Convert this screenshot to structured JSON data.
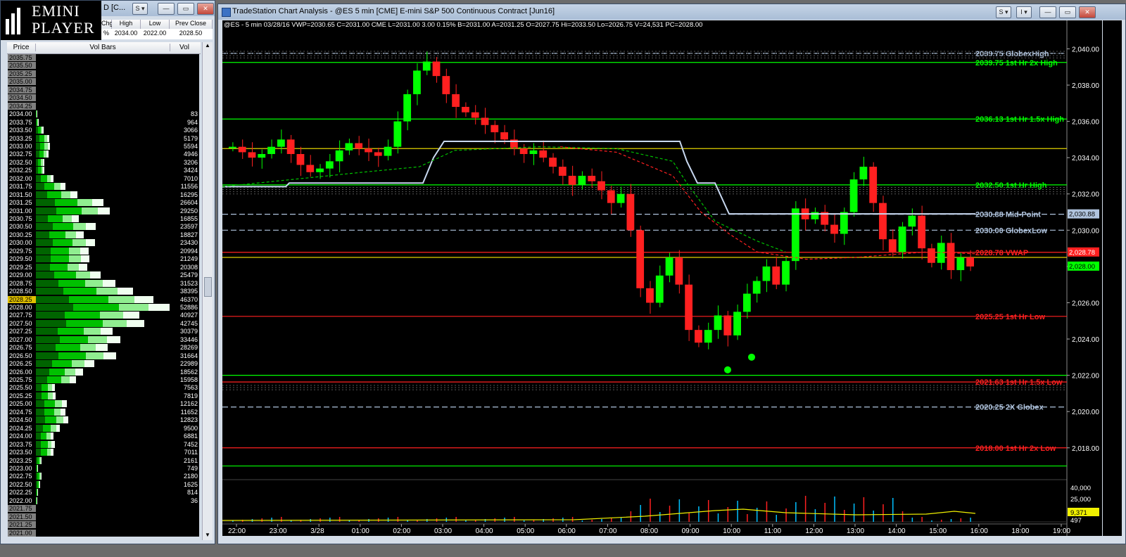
{
  "logo": {
    "line1": "EMINI",
    "line2": "PLAYER"
  },
  "dom_window": {
    "title": "D [C...",
    "header": {
      "col_chg": "Chg",
      "col_high": "High",
      "col_low": "Low",
      "col_prev": "Prev Close"
    },
    "values": {
      "pct": "%",
      "high": "2034.00",
      "low": "2022.00",
      "prev_close": "2028.50"
    },
    "columns": {
      "price": "Price",
      "bars": "Vol Bars",
      "vol": "Vol"
    },
    "current_price": "2028.25",
    "rows": [
      {
        "p": "2035.75",
        "v": ""
      },
      {
        "p": "2035.50",
        "v": ""
      },
      {
        "p": "2035.25",
        "v": ""
      },
      {
        "p": "2035.00",
        "v": ""
      },
      {
        "p": "2034.75",
        "v": ""
      },
      {
        "p": "2034.50",
        "v": ""
      },
      {
        "p": "2034.25",
        "v": ""
      },
      {
        "p": "2034.00",
        "v": "83"
      },
      {
        "p": "2033.75",
        "v": "964"
      },
      {
        "p": "2033.50",
        "v": "3066"
      },
      {
        "p": "2033.25",
        "v": "5179"
      },
      {
        "p": "2033.00",
        "v": "5594"
      },
      {
        "p": "2032.75",
        "v": "4946"
      },
      {
        "p": "2032.50",
        "v": "3206"
      },
      {
        "p": "2032.25",
        "v": "3424"
      },
      {
        "p": "2032.00",
        "v": "7010"
      },
      {
        "p": "2031.75",
        "v": "11556"
      },
      {
        "p": "2031.50",
        "v": "16295"
      },
      {
        "p": "2031.25",
        "v": "26604"
      },
      {
        "p": "2031.00",
        "v": "29250"
      },
      {
        "p": "2030.75",
        "v": "16855"
      },
      {
        "p": "2030.50",
        "v": "23597"
      },
      {
        "p": "2030.25",
        "v": "18827"
      },
      {
        "p": "2030.00",
        "v": "23430"
      },
      {
        "p": "2029.75",
        "v": "20994"
      },
      {
        "p": "2029.50",
        "v": "21249"
      },
      {
        "p": "2029.25",
        "v": "20308"
      },
      {
        "p": "2029.00",
        "v": "25479"
      },
      {
        "p": "2028.75",
        "v": "31523"
      },
      {
        "p": "2028.50",
        "v": "38395"
      },
      {
        "p": "2028.25",
        "v": "46370"
      },
      {
        "p": "2028.00",
        "v": "52886"
      },
      {
        "p": "2027.75",
        "v": "40927"
      },
      {
        "p": "2027.50",
        "v": "42745"
      },
      {
        "p": "2027.25",
        "v": "30379"
      },
      {
        "p": "2027.00",
        "v": "33446"
      },
      {
        "p": "2026.75",
        "v": "28269"
      },
      {
        "p": "2026.50",
        "v": "31664"
      },
      {
        "p": "2026.25",
        "v": "22989"
      },
      {
        "p": "2026.00",
        "v": "18562"
      },
      {
        "p": "2025.75",
        "v": "15958"
      },
      {
        "p": "2025.50",
        "v": "7563"
      },
      {
        "p": "2025.25",
        "v": "7819"
      },
      {
        "p": "2025.00",
        "v": "12162"
      },
      {
        "p": "2024.75",
        "v": "11652"
      },
      {
        "p": "2024.50",
        "v": "12823"
      },
      {
        "p": "2024.25",
        "v": "9500"
      },
      {
        "p": "2024.00",
        "v": "6881"
      },
      {
        "p": "2023.75",
        "v": "7452"
      },
      {
        "p": "2023.50",
        "v": "7011"
      },
      {
        "p": "2023.25",
        "v": "2161"
      },
      {
        "p": "2023.00",
        "v": "749"
      },
      {
        "p": "2022.75",
        "v": "2180"
      },
      {
        "p": "2022.50",
        "v": "1625"
      },
      {
        "p": "2022.25",
        "v": "814"
      },
      {
        "p": "2022.00",
        "v": "36"
      },
      {
        "p": "2021.75",
        "v": ""
      },
      {
        "p": "2021.50",
        "v": ""
      },
      {
        "p": "2021.25",
        "v": ""
      },
      {
        "p": "2021.00",
        "v": ""
      }
    ]
  },
  "chart_window": {
    "title": "TradeStation Chart Analysis - @ES 5 min [CME] E-mini S&P 500 Continuous Contract [Jun16]",
    "status_line": "@ES - 5 min  03/28/16  VWP=2030.65  C=2031.00  CME  L=2031.00  3.00  0.15%  B=2031.00  A=2031.25  O=2027.75  Hi=2033.50  Lo=2026.75  V=24,531  PC=2028.00"
  },
  "chart_data": {
    "type": "candlestick",
    "y_ticks": [
      "2,040.00",
      "2,038.00",
      "2,036.00",
      "2,034.00",
      "2,032.00",
      "2,030.00",
      "2,028.00",
      "2,026.00",
      "2,024.00",
      "2,022.00",
      "2,020.00",
      "2,018.00"
    ],
    "x_ticks": [
      "22:00",
      "23:00",
      "3/28",
      "01:00",
      "02:00",
      "03:00",
      "04:00",
      "05:00",
      "06:00",
      "07:00",
      "08:00",
      "09:00",
      "10:00",
      "11:00",
      "12:00",
      "13:00",
      "14:00",
      "15:00",
      "16:00",
      "18:00",
      "19:00"
    ],
    "price_flags": {
      "midpoint": "2,030.88",
      "vwap": "2,028.78",
      "last": "2,028.00"
    },
    "volume_ticks": [
      "40,000",
      "25,000",
      "9,371",
      "497"
    ],
    "levels": [
      {
        "label": "2039.75 GlobexHigh",
        "value": 2039.75,
        "color": "#b0c4de"
      },
      {
        "label": "2039.75 1st Hr  2x High",
        "value": 2039.25,
        "color": "#00ff00"
      },
      {
        "label": "2036.13 1st Hr  1.5x High",
        "value": 2036.13,
        "color": "#00ff00"
      },
      {
        "label": "2032.50 1st Hr  High",
        "value": 2032.5,
        "color": "#00ff00"
      },
      {
        "label": "2030.88 Mid-Point",
        "value": 2030.88,
        "color": "#b0c4de"
      },
      {
        "label": "2030.00 GlobexLow",
        "value": 2030.0,
        "color": "#b0c4de"
      },
      {
        "label": "2028.78 VWAP",
        "value": 2028.78,
        "color": "#ff2020"
      },
      {
        "label": "2025.25 1st Hr  Low",
        "value": 2025.25,
        "color": "#ff2020"
      },
      {
        "label": "2021.63 1st Hr  1.5x Low",
        "value": 2021.63,
        "color": "#ff2020"
      },
      {
        "label": "2020.25 2X Globex",
        "value": 2020.25,
        "color": "#b0c4de"
      },
      {
        "label": "2018.00 1st Hr  2x Low",
        "value": 2018.0,
        "color": "#ff2020"
      }
    ],
    "ohlc_close_path": [
      2034.6,
      2034.3,
      2034.0,
      2034.2,
      2034.6,
      2035.0,
      2034.2,
      2033.6,
      2033.2,
      2033.4,
      2033.8,
      2034.4,
      2034.8,
      2034.5,
      2034.3,
      2034.1,
      2034.6,
      2036.0,
      2037.5,
      2038.8,
      2039.3,
      2038.5,
      2037.5,
      2036.8,
      2036.5,
      2036.2,
      2035.8,
      2035.4,
      2035.0,
      2034.5,
      2034.2,
      2034.4,
      2034.0,
      2033.5,
      2033.0,
      2032.5,
      2033.0,
      2032.7,
      2032.2,
      2031.5,
      2032.0,
      2030.0,
      2026.8,
      2026.0,
      2027.5,
      2028.5,
      2027.0,
      2024.5,
      2023.8,
      2024.5,
      2025.3,
      2024.2,
      2025.5,
      2026.5,
      2027.2,
      2028.0,
      2027.0,
      2028.3,
      2031.2,
      2030.6,
      2031.0,
      2030.3,
      2029.8,
      2031.0,
      2032.8,
      2033.5,
      2031.5,
      2029.5,
      2028.8,
      2030.2,
      2030.8,
      2029.0,
      2028.2,
      2029.3,
      2027.8,
      2028.5,
      2028.0
    ]
  }
}
